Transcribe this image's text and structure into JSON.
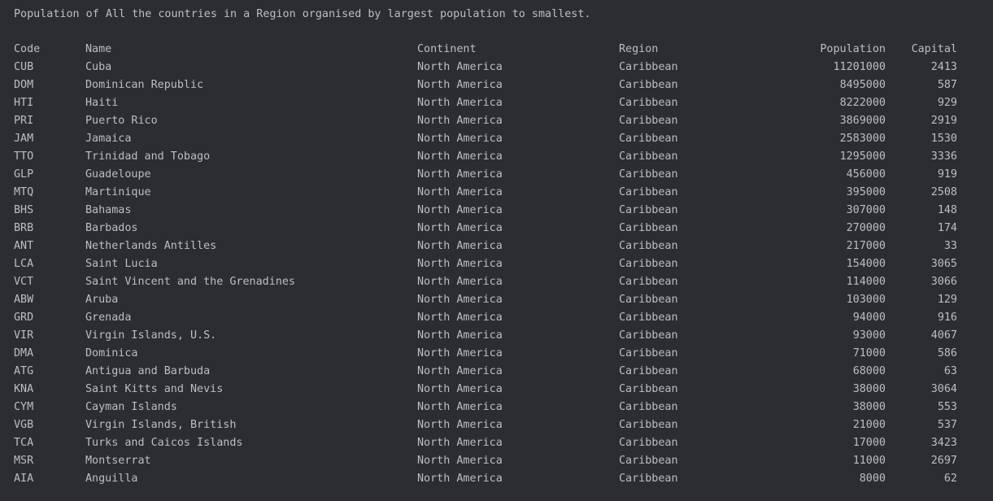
{
  "console": {
    "heading": "Population of All the countries in a Region organised by largest population to smallest.",
    "headers": {
      "code": "Code",
      "name": "Name",
      "continent": "Continent",
      "region": "Region",
      "population": "Population",
      "capital": "Capital"
    },
    "rows": [
      {
        "code": "CUB",
        "name": "Cuba",
        "continent": "North America",
        "region": "Caribbean",
        "population": "11201000",
        "capital": "2413"
      },
      {
        "code": "DOM",
        "name": "Dominican Republic",
        "continent": "North America",
        "region": "Caribbean",
        "population": "8495000",
        "capital": "587"
      },
      {
        "code": "HTI",
        "name": "Haiti",
        "continent": "North America",
        "region": "Caribbean",
        "population": "8222000",
        "capital": "929"
      },
      {
        "code": "PRI",
        "name": "Puerto Rico",
        "continent": "North America",
        "region": "Caribbean",
        "population": "3869000",
        "capital": "2919"
      },
      {
        "code": "JAM",
        "name": "Jamaica",
        "continent": "North America",
        "region": "Caribbean",
        "population": "2583000",
        "capital": "1530"
      },
      {
        "code": "TTO",
        "name": "Trinidad and Tobago",
        "continent": "North America",
        "region": "Caribbean",
        "population": "1295000",
        "capital": "3336"
      },
      {
        "code": "GLP",
        "name": "Guadeloupe",
        "continent": "North America",
        "region": "Caribbean",
        "population": "456000",
        "capital": "919"
      },
      {
        "code": "MTQ",
        "name": "Martinique",
        "continent": "North America",
        "region": "Caribbean",
        "population": "395000",
        "capital": "2508"
      },
      {
        "code": "BHS",
        "name": "Bahamas",
        "continent": "North America",
        "region": "Caribbean",
        "population": "307000",
        "capital": "148"
      },
      {
        "code": "BRB",
        "name": "Barbados",
        "continent": "North America",
        "region": "Caribbean",
        "population": "270000",
        "capital": "174"
      },
      {
        "code": "ANT",
        "name": "Netherlands Antilles",
        "continent": "North America",
        "region": "Caribbean",
        "population": "217000",
        "capital": "33"
      },
      {
        "code": "LCA",
        "name": "Saint Lucia",
        "continent": "North America",
        "region": "Caribbean",
        "population": "154000",
        "capital": "3065"
      },
      {
        "code": "VCT",
        "name": "Saint Vincent and the Grenadines",
        "continent": "North America",
        "region": "Caribbean",
        "population": "114000",
        "capital": "3066"
      },
      {
        "code": "ABW",
        "name": "Aruba",
        "continent": "North America",
        "region": "Caribbean",
        "population": "103000",
        "capital": "129"
      },
      {
        "code": "GRD",
        "name": "Grenada",
        "continent": "North America",
        "region": "Caribbean",
        "population": "94000",
        "capital": "916"
      },
      {
        "code": "VIR",
        "name": "Virgin Islands, U.S.",
        "continent": "North America",
        "region": "Caribbean",
        "population": "93000",
        "capital": "4067"
      },
      {
        "code": "DMA",
        "name": "Dominica",
        "continent": "North America",
        "region": "Caribbean",
        "population": "71000",
        "capital": "586"
      },
      {
        "code": "ATG",
        "name": "Antigua and Barbuda",
        "continent": "North America",
        "region": "Caribbean",
        "population": "68000",
        "capital": "63"
      },
      {
        "code": "KNA",
        "name": "Saint Kitts and Nevis",
        "continent": "North America",
        "region": "Caribbean",
        "population": "38000",
        "capital": "3064"
      },
      {
        "code": "CYM",
        "name": "Cayman Islands",
        "continent": "North America",
        "region": "Caribbean",
        "population": "38000",
        "capital": "553"
      },
      {
        "code": "VGB",
        "name": "Virgin Islands, British",
        "continent": "North America",
        "region": "Caribbean",
        "population": "21000",
        "capital": "537"
      },
      {
        "code": "TCA",
        "name": "Turks and Caicos Islands",
        "continent": "North America",
        "region": "Caribbean",
        "population": "17000",
        "capital": "3423"
      },
      {
        "code": "MSR",
        "name": "Montserrat",
        "continent": "North America",
        "region": "Caribbean",
        "population": "11000",
        "capital": "2697"
      },
      {
        "code": "AIA",
        "name": "Anguilla",
        "continent": "North America",
        "region": "Caribbean",
        "population": "8000",
        "capital": "62"
      }
    ]
  }
}
